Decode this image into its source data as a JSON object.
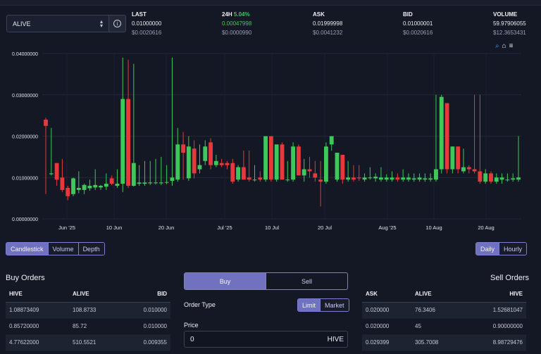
{
  "token": {
    "selected": "ALIVE"
  },
  "stats": {
    "last": {
      "label": "LAST",
      "value": "0.01000000",
      "usd": "$0.0020616"
    },
    "change": {
      "label": "24H",
      "pct": "5.04%",
      "value": "0.00047998",
      "usd": "$0.0000990"
    },
    "ask": {
      "label": "ASK",
      "value": "0.01999998",
      "usd": "$0.0041232"
    },
    "bid": {
      "label": "BID",
      "value": "0.01000001",
      "usd": "$0.0020616"
    },
    "volume": {
      "label": "VOLUME",
      "value": "59.97906055",
      "usd": "$12.3653431"
    }
  },
  "chart_data": {
    "type": "candlestick",
    "y_ticks": [
      "0.00000000",
      "0.01000000",
      "0.02000000",
      "0.03000000",
      "0.04000000"
    ],
    "ylim": [
      0,
      0.04
    ],
    "x_ticks": [
      "Jun '25",
      "10 Jun",
      "20 Jun",
      "Jul '25",
      "10 Jul",
      "20 Jul",
      "Aug '25",
      "10 Aug",
      "20 Aug"
    ],
    "colors": {
      "up": "#3fc85a",
      "down": "#e5393b"
    },
    "candles": [
      {
        "o": 0.024,
        "h": 0.0245,
        "l": 0.006,
        "c": 0.0225
      },
      {
        "o": 0.0108,
        "h": 0.022,
        "l": 0.0105,
        "c": 0.011
      },
      {
        "o": 0.0135,
        "h": 0.0135,
        "l": 0.008,
        "c": 0.0095
      },
      {
        "o": 0.01,
        "h": 0.0145,
        "l": 0.0065,
        "c": 0.007
      },
      {
        "o": 0.0075,
        "h": 0.008,
        "l": 0.0045,
        "c": 0.0055
      },
      {
        "o": 0.006,
        "h": 0.01,
        "l": 0.0055,
        "c": 0.0098
      },
      {
        "o": 0.007,
        "h": 0.0115,
        "l": 0.0062,
        "c": 0.0075
      },
      {
        "o": 0.007,
        "h": 0.0085,
        "l": 0.006,
        "c": 0.0082
      },
      {
        "o": 0.0074,
        "h": 0.0095,
        "l": 0.0068,
        "c": 0.008
      },
      {
        "o": 0.0076,
        "h": 0.012,
        "l": 0.007,
        "c": 0.0082
      },
      {
        "o": 0.0076,
        "h": 0.0082,
        "l": 0.007,
        "c": 0.008
      },
      {
        "o": 0.0078,
        "h": 0.011,
        "l": 0.007,
        "c": 0.0085
      },
      {
        "o": 0.0098,
        "h": 0.0105,
        "l": 0.0082,
        "c": 0.0085
      },
      {
        "o": 0.008,
        "h": 0.012,
        "l": 0.0075,
        "c": 0.0085
      },
      {
        "o": 0.0085,
        "h": 0.039,
        "l": 0.0065,
        "c": 0.029
      },
      {
        "o": 0.029,
        "h": 0.0385,
        "l": 0.0075,
        "c": 0.008
      },
      {
        "o": 0.008,
        "h": 0.0375,
        "l": 0.0078,
        "c": 0.0135
      },
      {
        "o": 0.0085,
        "h": 0.013,
        "l": 0.008,
        "c": 0.0088
      },
      {
        "o": 0.0085,
        "h": 0.014,
        "l": 0.008,
        "c": 0.0088
      },
      {
        "o": 0.0086,
        "h": 0.014,
        "l": 0.0082,
        "c": 0.0088
      },
      {
        "o": 0.0087,
        "h": 0.0145,
        "l": 0.0083,
        "c": 0.0088
      },
      {
        "o": 0.0086,
        "h": 0.015,
        "l": 0.0082,
        "c": 0.0088
      },
      {
        "o": 0.0088,
        "h": 0.013,
        "l": 0.0084,
        "c": 0.0089
      },
      {
        "o": 0.0092,
        "h": 0.039,
        "l": 0.008,
        "c": 0.01
      },
      {
        "o": 0.0095,
        "h": 0.022,
        "l": 0.009,
        "c": 0.018
      },
      {
        "o": 0.018,
        "h": 0.021,
        "l": 0.0095,
        "c": 0.016
      },
      {
        "o": 0.0098,
        "h": 0.02,
        "l": 0.0092,
        "c": 0.0175
      },
      {
        "o": 0.017,
        "h": 0.019,
        "l": 0.0098,
        "c": 0.011
      },
      {
        "o": 0.012,
        "h": 0.018,
        "l": 0.011,
        "c": 0.013
      },
      {
        "o": 0.014,
        "h": 0.019,
        "l": 0.013,
        "c": 0.0175
      },
      {
        "o": 0.0185,
        "h": 0.0195,
        "l": 0.012,
        "c": 0.013
      },
      {
        "o": 0.013,
        "h": 0.0155,
        "l": 0.0125,
        "c": 0.014
      },
      {
        "o": 0.0135,
        "h": 0.0145,
        "l": 0.0125,
        "c": 0.013
      },
      {
        "o": 0.0135,
        "h": 0.014,
        "l": 0.012,
        "c": 0.013
      },
      {
        "o": 0.0135,
        "h": 0.0145,
        "l": 0.0085,
        "c": 0.009
      },
      {
        "o": 0.0095,
        "h": 0.013,
        "l": 0.009,
        "c": 0.0125
      },
      {
        "o": 0.0125,
        "h": 0.0165,
        "l": 0.0095,
        "c": 0.0095
      },
      {
        "o": 0.01,
        "h": 0.0165,
        "l": 0.009,
        "c": 0.0095
      },
      {
        "o": 0.0095,
        "h": 0.013,
        "l": 0.009,
        "c": 0.0095
      },
      {
        "o": 0.01,
        "h": 0.0115,
        "l": 0.009,
        "c": 0.0095
      },
      {
        "o": 0.0095,
        "h": 0.02,
        "l": 0.009,
        "c": 0.02
      },
      {
        "o": 0.02,
        "h": 0.02,
        "l": 0.009,
        "c": 0.0095
      },
      {
        "o": 0.0095,
        "h": 0.0175,
        "l": 0.009,
        "c": 0.018
      },
      {
        "o": 0.018,
        "h": 0.0185,
        "l": 0.0095,
        "c": 0.0095
      },
      {
        "o": 0.0095,
        "h": 0.014,
        "l": 0.009,
        "c": 0.0095
      },
      {
        "o": 0.0095,
        "h": 0.0185,
        "l": 0.009,
        "c": 0.0175
      },
      {
        "o": 0.0175,
        "h": 0.018,
        "l": 0.0105,
        "c": 0.0105
      },
      {
        "o": 0.0105,
        "h": 0.0145,
        "l": 0.009,
        "c": 0.012
      },
      {
        "o": 0.012,
        "h": 0.015,
        "l": 0.01,
        "c": 0.0115
      },
      {
        "o": 0.011,
        "h": 0.014,
        "l": 0.009,
        "c": 0.01
      },
      {
        "o": 0.0095,
        "h": 0.014,
        "l": 0.003,
        "c": 0.009
      },
      {
        "o": 0.009,
        "h": 0.0185,
        "l": 0.0085,
        "c": 0.0175
      },
      {
        "o": 0.018,
        "h": 0.02,
        "l": 0.0165,
        "c": 0.02
      },
      {
        "o": 0.0095,
        "h": 0.016,
        "l": 0.009,
        "c": 0.016
      },
      {
        "o": 0.0155,
        "h": 0.0155,
        "l": 0.0085,
        "c": 0.0095
      },
      {
        "o": 0.0095,
        "h": 0.014,
        "l": 0.009,
        "c": 0.01
      },
      {
        "o": 0.01,
        "h": 0.013,
        "l": 0.009,
        "c": 0.0095
      },
      {
        "o": 0.01,
        "h": 0.013,
        "l": 0.0092,
        "c": 0.0098
      },
      {
        "o": 0.0095,
        "h": 0.011,
        "l": 0.009,
        "c": 0.01
      },
      {
        "o": 0.01,
        "h": 0.0125,
        "l": 0.0095,
        "c": 0.01
      },
      {
        "o": 0.0098,
        "h": 0.011,
        "l": 0.009,
        "c": 0.0102
      },
      {
        "o": 0.0095,
        "h": 0.0125,
        "l": 0.009,
        "c": 0.01
      },
      {
        "o": 0.0095,
        "h": 0.0108,
        "l": 0.009,
        "c": 0.01
      },
      {
        "o": 0.0095,
        "h": 0.0115,
        "l": 0.009,
        "c": 0.01
      },
      {
        "o": 0.01,
        "h": 0.011,
        "l": 0.009,
        "c": 0.0095
      },
      {
        "o": 0.0095,
        "h": 0.012,
        "l": 0.009,
        "c": 0.01
      },
      {
        "o": 0.0095,
        "h": 0.011,
        "l": 0.009,
        "c": 0.01
      },
      {
        "o": 0.0095,
        "h": 0.011,
        "l": 0.009,
        "c": 0.0098
      },
      {
        "o": 0.0095,
        "h": 0.011,
        "l": 0.009,
        "c": 0.01
      },
      {
        "o": 0.0095,
        "h": 0.011,
        "l": 0.009,
        "c": 0.0098
      },
      {
        "o": 0.0095,
        "h": 0.011,
        "l": 0.009,
        "c": 0.0098
      },
      {
        "o": 0.0095,
        "h": 0.03,
        "l": 0.009,
        "c": 0.012
      },
      {
        "o": 0.012,
        "h": 0.03,
        "l": 0.011,
        "c": 0.0295
      },
      {
        "o": 0.028,
        "h": 0.028,
        "l": 0.011,
        "c": 0.012
      },
      {
        "o": 0.012,
        "h": 0.0175,
        "l": 0.011,
        "c": 0.0175
      },
      {
        "o": 0.0175,
        "h": 0.0175,
        "l": 0.011,
        "c": 0.012
      },
      {
        "o": 0.0115,
        "h": 0.017,
        "l": 0.011,
        "c": 0.0125
      },
      {
        "o": 0.0125,
        "h": 0.013,
        "l": 0.011,
        "c": 0.012
      },
      {
        "o": 0.012,
        "h": 0.03,
        "l": 0.011,
        "c": 0.0115
      },
      {
        "o": 0.0115,
        "h": 0.03,
        "l": 0.0085,
        "c": 0.009
      },
      {
        "o": 0.009,
        "h": 0.012,
        "l": 0.0085,
        "c": 0.011
      },
      {
        "o": 0.011,
        "h": 0.0115,
        "l": 0.0085,
        "c": 0.009
      },
      {
        "o": 0.009,
        "h": 0.011,
        "l": 0.0085,
        "c": 0.01
      },
      {
        "o": 0.0095,
        "h": 0.011,
        "l": 0.0085,
        "c": 0.01
      },
      {
        "o": 0.0095,
        "h": 0.011,
        "l": 0.009,
        "c": 0.0095
      },
      {
        "o": 0.0095,
        "h": 0.011,
        "l": 0.009,
        "c": 0.0098
      },
      {
        "o": 0.0095,
        "h": 0.02,
        "l": 0.009,
        "c": 0.01
      }
    ]
  },
  "chart_tabs": {
    "items": [
      "Candlestick",
      "Volume",
      "Depth"
    ],
    "active": 0
  },
  "period_tabs": {
    "items": [
      "Daily",
      "Hourly"
    ],
    "active": 0
  },
  "buy_orders": {
    "title": "Buy Orders",
    "headers": [
      "HIVE",
      "ALIVE",
      "BID"
    ],
    "rows": [
      [
        "1.08873409",
        "108.8733",
        "0.010000"
      ],
      [
        "0.85720000",
        "85.72",
        "0.010000"
      ],
      [
        "4.77622000",
        "510.5521",
        "0.009355"
      ]
    ]
  },
  "sell_orders": {
    "title": "Sell Orders",
    "headers": [
      "ASK",
      "ALIVE",
      "HIVE"
    ],
    "rows": [
      [
        "0.020000",
        "76.3406",
        "1.52681047"
      ],
      [
        "0.020000",
        "45",
        "0.90000000"
      ],
      [
        "0.029399",
        "305.7008",
        "8.98729476"
      ]
    ]
  },
  "order_form": {
    "side_tabs": [
      "Buy",
      "Sell"
    ],
    "order_type_label": "Order Type",
    "order_types": [
      "Limit",
      "Market"
    ],
    "price_label": "Price",
    "price_value": "0",
    "price_unit": "HIVE"
  }
}
